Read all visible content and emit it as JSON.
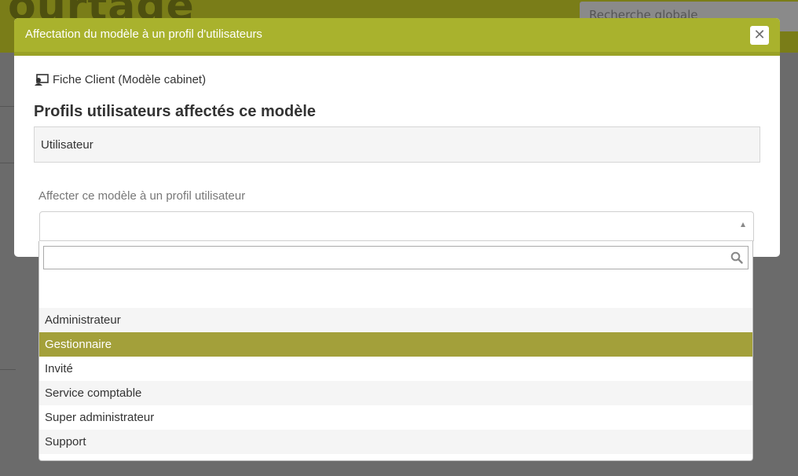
{
  "background": {
    "logo_text": "ourtage",
    "search_placeholder": "Recherche globale"
  },
  "modal": {
    "title": "Affectation du modèle à un profil d'utilisateurs",
    "close_label": "✕",
    "template_name": "Fiche Client (Modèle cabinet)",
    "section_title": "Profils utilisateurs affectés ce modèle",
    "assigned_profile": "Utilisateur",
    "assign_label": "Affecter ce modèle à un profil utilisateur",
    "select_value": ""
  },
  "dropdown": {
    "search_value": "",
    "options": [
      {
        "label": ""
      },
      {
        "label": "Administrateur"
      },
      {
        "label": "Gestionnaire",
        "selected": true
      },
      {
        "label": "Invité"
      },
      {
        "label": "Service comptable"
      },
      {
        "label": "Super administrateur"
      },
      {
        "label": "Support"
      }
    ]
  },
  "colors": {
    "accent": "#a9b22d",
    "highlight": "#a3a03a"
  }
}
